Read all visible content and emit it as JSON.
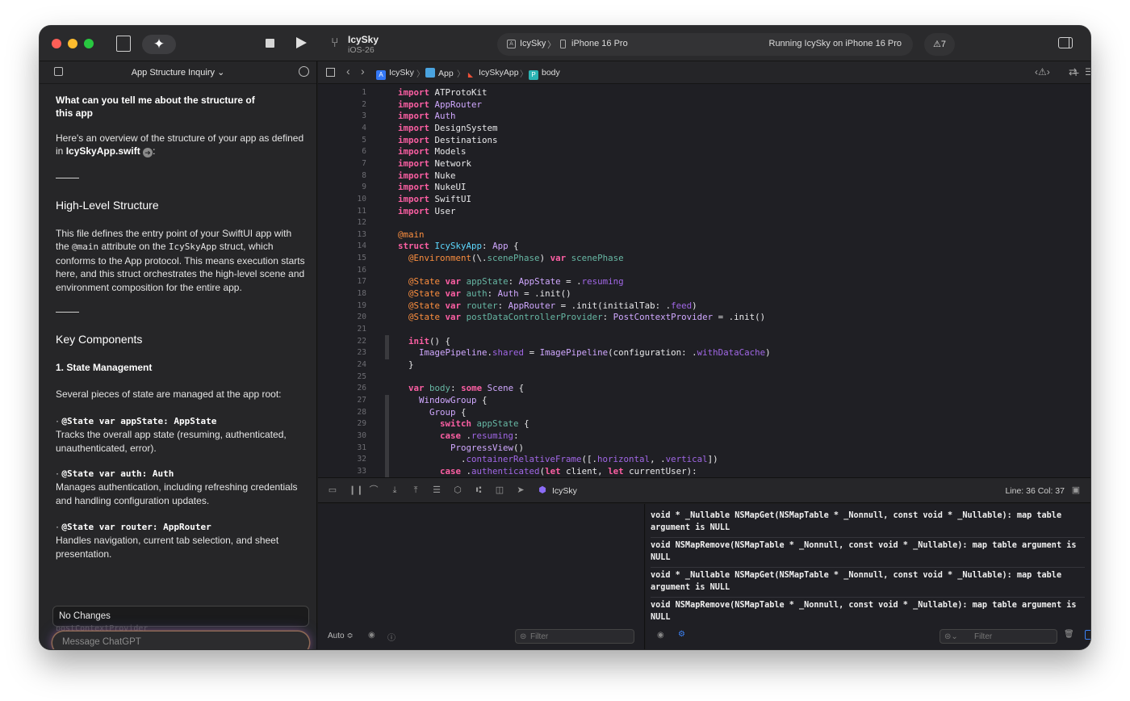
{
  "toolbar": {
    "project_name": "IcySky",
    "project_target": "iOS-26",
    "scheme": "IcySky",
    "scheme_sep": "〉",
    "device": "iPhone 16 Pro",
    "status": "Running IcySky on iPhone 16 Pro",
    "warnings": "7",
    "icons": [
      "document-icon",
      "sparkle-icon",
      "stop-icon",
      "play-icon",
      "branch-icon",
      "sidebar-toggle-icon"
    ]
  },
  "chat": {
    "title": "App Structure Inquiry",
    "title_caret": "⌄",
    "question": "What can you tell me about the structure of this app",
    "intro_a": "Here's an overview of the structure of your app as defined in ",
    "intro_file": "IcySkyApp.swift",
    "intro_b": ":",
    "h_highlevel": "High-Level Structure",
    "p1_a": "This file defines the entry point of your SwiftUI app with the ",
    "p1_main": "@main",
    "p1_b": " attribute on the ",
    "p1_struct": "IcySkyApp",
    "p1_c": " struct, which conforms to the App protocol. This means execution starts here, and this struct orchestrates the high-level scene and environment composition for the entire app.",
    "h_key": "Key Components",
    "h_state": "1. State Management",
    "state_intro": "Several pieces of state are managed at the app root:",
    "items": [
      {
        "code": "@State var appState: AppState",
        "desc": "Tracks the overall app state (resuming, authenticated, unauthenticated, error)."
      },
      {
        "code": "@State var auth: Auth",
        "desc": "Manages authentication, including refreshing credentials and handling configuration updates."
      },
      {
        "code": "@State var router: AppRouter",
        "desc": "Handles navigation, current tab selection, and sheet presentation."
      }
    ],
    "no_changes": "No Changes",
    "ghost": "postContextProvider",
    "message_placeholder": "Message ChatGPT"
  },
  "editor": {
    "breadcrumb": [
      "IcySky",
      "App",
      "IcySkyApp",
      "body"
    ],
    "line_numbers": [
      "1",
      "2",
      "3",
      "4",
      "5",
      "6",
      "7",
      "8",
      "9",
      "10",
      "11",
      "12",
      "13",
      "14",
      "15",
      "16",
      "17",
      "18",
      "19",
      "20",
      "21",
      "22",
      "23",
      "24",
      "25",
      "26",
      "27",
      "28",
      "29",
      "30",
      "31",
      "32",
      "33"
    ],
    "code_lines": [
      "import ATProtoKit",
      "import AppRouter",
      "import Auth",
      "import DesignSystem",
      "import Destinations",
      "import Models",
      "import Network",
      "import Nuke",
      "import NukeUI",
      "import SwiftUI",
      "import User",
      "",
      "@main",
      "struct IcySkyApp: App {",
      "  @Environment(\\.scenePhase) var scenePhase",
      "",
      "  @State var appState: AppState = .resuming",
      "  @State var auth: Auth = .init()",
      "  @State var router: AppRouter = .init(initialTab: .feed)",
      "  @State var postDataControllerProvider: PostContextProvider = .init()",
      "",
      "  init() {",
      "    ImagePipeline.shared = ImagePipeline(configuration: .withDataCache)",
      "  }",
      "",
      "  var body: some Scene {",
      "    WindowGroup {",
      "      Group {",
      "        switch appState {",
      "        case .resuming:",
      "          ProgressView()",
      "            .containerRelativeFrame([.horizontal, .vertical])",
      "        case .authenticated(let client, let currentUser):"
    ]
  },
  "debug": {
    "scheme": "IcySky",
    "line_col": "Line: 36  Col: 37",
    "auto": "Auto ≎",
    "filter_placeholder": "Filter"
  },
  "console": {
    "lines": [
      "void * _Nullable NSMapGet(NSMapTable * _Nonnull, const void * _Nullable): map table argument is NULL",
      "void NSMapRemove(NSMapTable * _Nonnull, const void * _Nullable): map table argument is NULL",
      "void * _Nullable NSMapGet(NSMapTable * _Nonnull, const void * _Nullable): map table argument is NULL",
      "void NSMapRemove(NSMapTable * _Nonnull, const void * _Nullable): map table argument is NULL"
    ],
    "filter_placeholder": "Filter"
  }
}
